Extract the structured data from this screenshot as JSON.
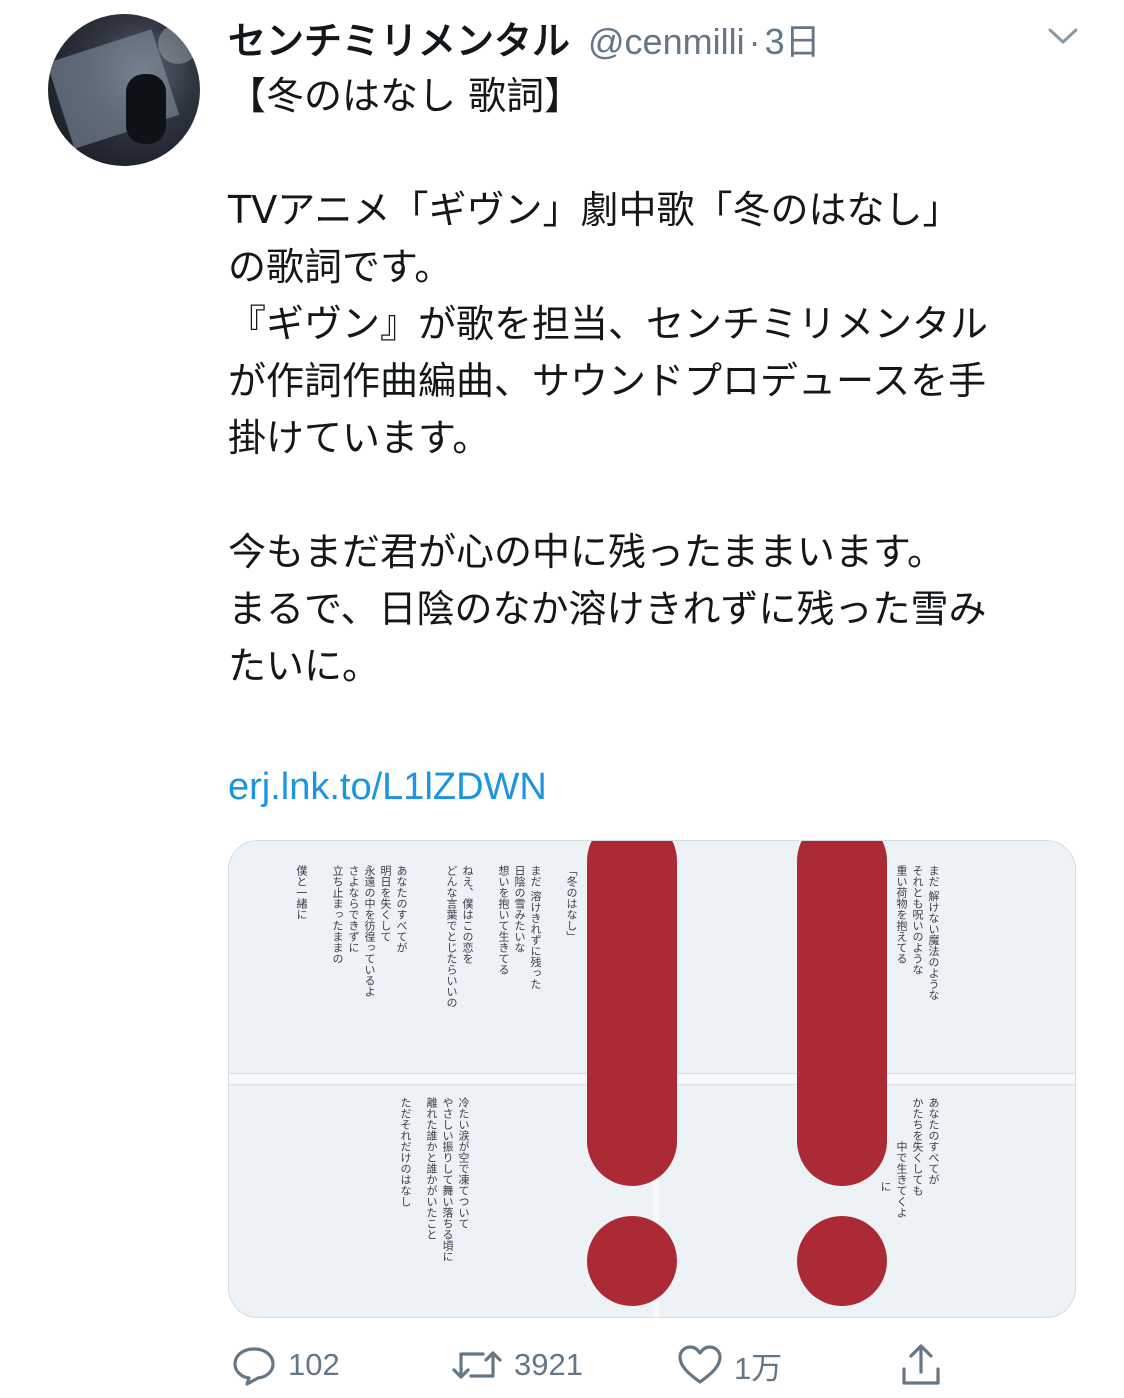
{
  "colors": {
    "text": "#14171a",
    "muted": "#657786",
    "link": "#1b95e0",
    "mark": "#ac2a35"
  },
  "author": {
    "display_name": "センチミリメンタル",
    "handle": "@cenmilli",
    "separator": "·",
    "time": "3日"
  },
  "menu": {
    "icon": "chevron-down-icon"
  },
  "tweet": {
    "title": "【冬のはなし 歌詞】",
    "para1": "TVアニメ「ギヴン」劇中歌「冬のはなし」\nの歌詞です。\n『ギヴン』が歌を担当、センチミリメンタル\nが作詞作曲編曲、サウンドプロデュースを手\n掛けています。",
    "para2": "今もまだ君が心の中に残ったままいます。\nまるで、日陰のなか溶けきれずに残った雪み\nたいに。",
    "link": "erj.lnk.to/L1lZDWN"
  },
  "media": {
    "lyrics_tl": [
      "「冬のはなし」",
      "まだ 溶けきれずに残った",
      "日陰の雪みたいな",
      "想いを抱いて生きてる",
      "ねえ、僕はこの恋を",
      "どんな言葉でとじたらいいの",
      "あなたのすべてが",
      "明日を失くして",
      "永遠の中を彷徨っているよ",
      "さよならできずに",
      "立ち止まったままの",
      "僕と一緒に"
    ],
    "lyrics_tr": [
      "まだ 解けない魔法のような",
      "それとも呪いのような",
      "重い荷物を抱えてる"
    ],
    "lyrics_bl": [
      "冷たい涙が空で凍てついて",
      "やさしい振りして舞い落ちる頃に",
      "離れた誰かと誰かがいたこと",
      "ただそれだけのはなし"
    ],
    "lyrics_br": [
      "あなたのすべてが",
      "かたちを失くしても",
      "中で生きてくよ",
      "に"
    ]
  },
  "actions": {
    "reply": {
      "icon": "reply-icon",
      "count": "102"
    },
    "retweet": {
      "icon": "retweet-icon",
      "count": "3921"
    },
    "like": {
      "icon": "heart-icon",
      "count": "1万"
    },
    "share": {
      "icon": "share-icon"
    }
  }
}
